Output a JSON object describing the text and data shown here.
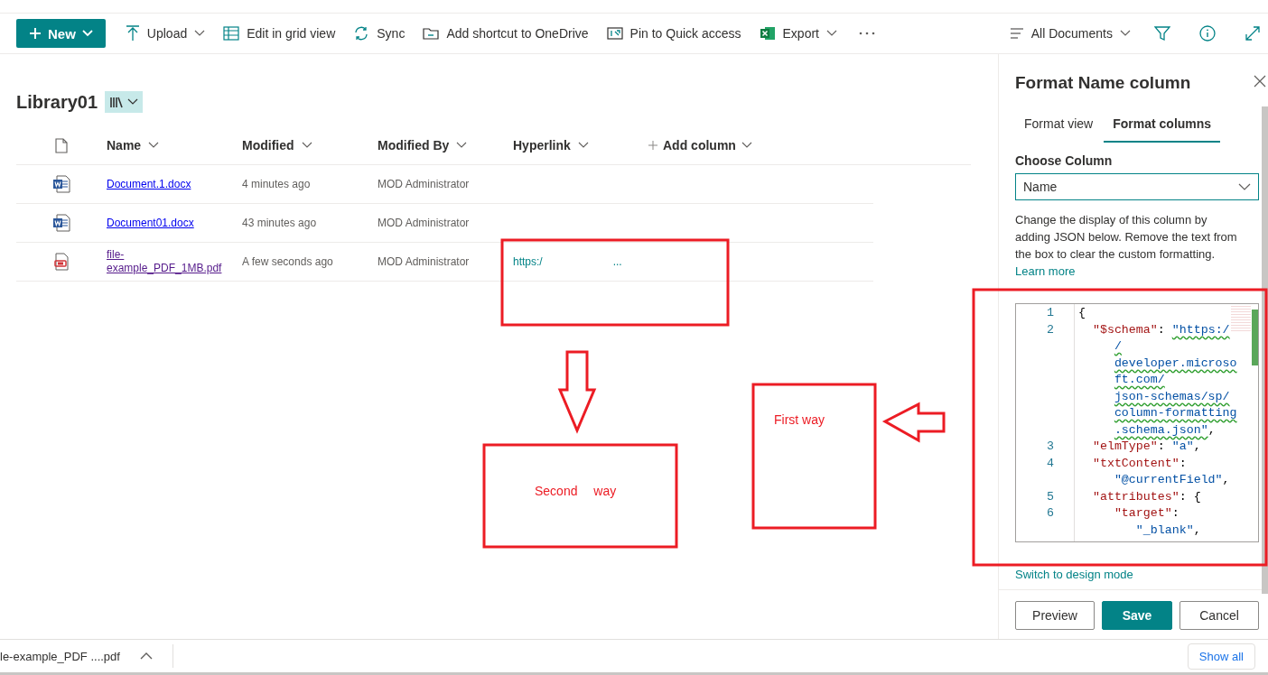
{
  "command_bar": {
    "new_label": "New",
    "items": [
      {
        "kind": "upload",
        "label": "Upload",
        "dropdown": true
      },
      {
        "kind": "grid",
        "label": "Edit in grid view",
        "dropdown": false
      },
      {
        "kind": "sync",
        "label": "Sync",
        "dropdown": false
      },
      {
        "kind": "shortcut",
        "label": "Add shortcut to OneDrive",
        "dropdown": false
      },
      {
        "kind": "pin",
        "label": "Pin to Quick access",
        "dropdown": false
      },
      {
        "kind": "excel",
        "label": "Export",
        "dropdown": true
      }
    ],
    "view_label": "All Documents"
  },
  "library": {
    "title": "Library01"
  },
  "table": {
    "columns": [
      "Name",
      "Modified",
      "Modified By",
      "Hyperlink"
    ],
    "add_column": "Add column",
    "rows": [
      {
        "kind": "word",
        "name": "Document.1.docx",
        "visited": false,
        "modified": "4 minutes ago",
        "modified_by": "MOD Administrator"
      },
      {
        "kind": "word",
        "name": "Document01.docx",
        "visited": false,
        "modified": "43 minutes ago",
        "modified_by": "MOD Administrator"
      },
      {
        "kind": "pdf",
        "name": "file-example_PDF_1MB.pdf",
        "visited": true,
        "modified": "A few seconds ago",
        "modified_by": "MOD Administrator",
        "hyperlink": "https:/",
        "hyperlink_end": "..."
      }
    ]
  },
  "panel": {
    "title": "Format Name column",
    "tabs": [
      {
        "label": "Format view",
        "selected": false
      },
      {
        "label": "Format columns",
        "selected": true
      }
    ],
    "choose_label": "Choose Column",
    "choose_value": "Name",
    "description": "Change the display of this column by adding JSON below. Remove the text from the box to clear the custom formatting.",
    "learn_more": "Learn more",
    "code": [
      {
        "num": "1",
        "kind": "root",
        "parts": [
          {
            "kind": "punct",
            "text": "{"
          }
        ]
      },
      {
        "num": "2",
        "kind": "member",
        "parts": [
          {
            "kind": "key",
            "text": "\"$schema\""
          },
          {
            "kind": "punct",
            "text": ": "
          },
          {
            "kind": "link",
            "text": "\"https:/"
          }
        ]
      },
      {
        "kind": "continued",
        "parts": [
          {
            "kind": "link",
            "text": "/"
          }
        ]
      },
      {
        "kind": "continued",
        "parts": [
          {
            "kind": "link",
            "text": "developer.microso"
          }
        ]
      },
      {
        "kind": "continued",
        "parts": [
          {
            "kind": "link",
            "text": "ft.com/"
          }
        ]
      },
      {
        "kind": "continued",
        "parts": [
          {
            "kind": "link",
            "text": "json-schemas/sp/"
          }
        ]
      },
      {
        "kind": "continued",
        "parts": [
          {
            "kind": "link",
            "text": "column-formatting"
          }
        ]
      },
      {
        "kind": "continued",
        "parts": [
          {
            "kind": "link",
            "text": ".schema.json\""
          },
          {
            "kind": "punct",
            "text": ","
          }
        ]
      },
      {
        "num": "3",
        "kind": "member",
        "parts": [
          {
            "kind": "key",
            "text": "\"elmType\""
          },
          {
            "kind": "punct",
            "text": ": "
          },
          {
            "kind": "str",
            "text": "\"a\""
          },
          {
            "kind": "punct",
            "text": ","
          }
        ]
      },
      {
        "num": "4",
        "kind": "member",
        "parts": [
          {
            "kind": "key",
            "text": "\"txtContent\""
          },
          {
            "kind": "punct",
            "text": ":"
          }
        ]
      },
      {
        "kind": "continued",
        "parts": [
          {
            "kind": "str",
            "text": "\"@currentField\""
          },
          {
            "kind": "punct",
            "text": ","
          }
        ]
      },
      {
        "num": "5",
        "kind": "member",
        "parts": [
          {
            "kind": "key",
            "text": "\"attributes\""
          },
          {
            "kind": "punct",
            "text": ": {"
          }
        ]
      },
      {
        "num": "6",
        "kind": "nested",
        "parts": [
          {
            "kind": "key",
            "text": "\"target\""
          },
          {
            "kind": "punct",
            "text": ":"
          }
        ]
      },
      {
        "kind": "nested_value",
        "parts": [
          {
            "kind": "str",
            "text": "\"_blank\""
          },
          {
            "kind": "punct",
            "text": ","
          }
        ]
      }
    ],
    "design_mode": "Switch to design mode",
    "buttons": [
      {
        "kind": "secondary",
        "label": "Preview"
      },
      {
        "kind": "primary",
        "label": "Save"
      },
      {
        "kind": "secondary",
        "label": "Cancel"
      }
    ]
  },
  "downloads": {
    "file": "le-example_PDF ....pdf",
    "show_all": "Show all"
  },
  "annotations": [
    {
      "text": "Second way"
    },
    {
      "text": "First way"
    }
  ]
}
